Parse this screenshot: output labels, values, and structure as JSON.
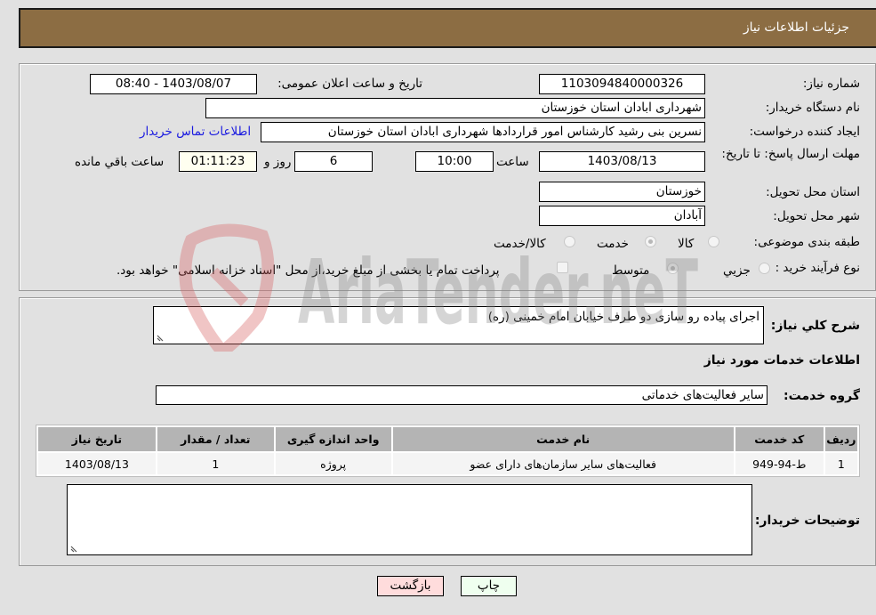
{
  "header": {
    "title": "جزئیات اطلاعات نیاز"
  },
  "fields": {
    "need_number": {
      "label": "شماره نیاز:",
      "value": "1103094840000326"
    },
    "announce_datetime": {
      "label": "تاریخ و ساعت اعلان عمومی:",
      "value": "1403/08/07 - 08:40"
    },
    "buyer_org": {
      "label": "نام دستگاه خریدار:",
      "value": "شهرداری ابادان استان خوزستان"
    },
    "creator": {
      "label": "ایجاد کننده درخواست:",
      "value": "نسرین بنی رشید کارشناس امور قراردادها شهرداری ابادان استان خوزستان"
    },
    "buyer_contact_link": "اطلاعات تماس خریدار",
    "deadline": {
      "label": "مهلت ارسال پاسخ: تا تاریخ:",
      "date": "1403/08/13",
      "time_label": "ساعت",
      "time": "10:00",
      "days": "6",
      "days_label": "روز و",
      "remaining": "01:11:23",
      "remaining_label": "ساعت باقي مانده"
    },
    "delivery_province": {
      "label": "استان محل تحویل:",
      "value": "خوزستان"
    },
    "delivery_city": {
      "label": "شهر محل تحویل:",
      "value": "آبادان"
    },
    "category": {
      "label": "طبقه بندی موضوعی:",
      "options": [
        "کالا",
        "خدمت",
        "کالا/خدمت"
      ],
      "selected": "خدمت"
    },
    "purchase_type": {
      "label": "نوع فرآیند خرید :",
      "options": [
        "جزیي",
        "متوسط"
      ],
      "selected": "متوسط",
      "treasury_checkbox_label": "پرداخت تمام یا بخشی از مبلغ خرید،از محل \"اسناد خزانه اسلامی\" خواهد بود.",
      "treasury_checked": false
    }
  },
  "description": {
    "label": "شرح کلي نیاز:",
    "value": "اجرای پیاده رو سازی دو طرف خیابان امام خمینی (ره)"
  },
  "services_section_title": "اطلاعات خدمات مورد نیاز",
  "service_group": {
    "label": "گروه خدمت:",
    "value": "سایر فعالیت‌های خدماتی"
  },
  "services_table": {
    "columns": [
      "ردیف",
      "کد خدمت",
      "نام خدمت",
      "واحد اندازه گیری",
      "تعداد / مقدار",
      "تاریخ نیاز"
    ],
    "rows": [
      [
        "1",
        "ط-94-949",
        "فعالیت‌های سایر سازمان‌های دارای عضو",
        "پروژه",
        "1",
        "1403/08/13"
      ]
    ]
  },
  "buyer_notes": {
    "label": "توضیحات خریدار:",
    "value": ""
  },
  "buttons": {
    "print": "چاپ",
    "back": "بازگشت"
  },
  "watermark": {
    "text": "AriaTender.neT",
    "color_logo": "#d9a0a0"
  }
}
